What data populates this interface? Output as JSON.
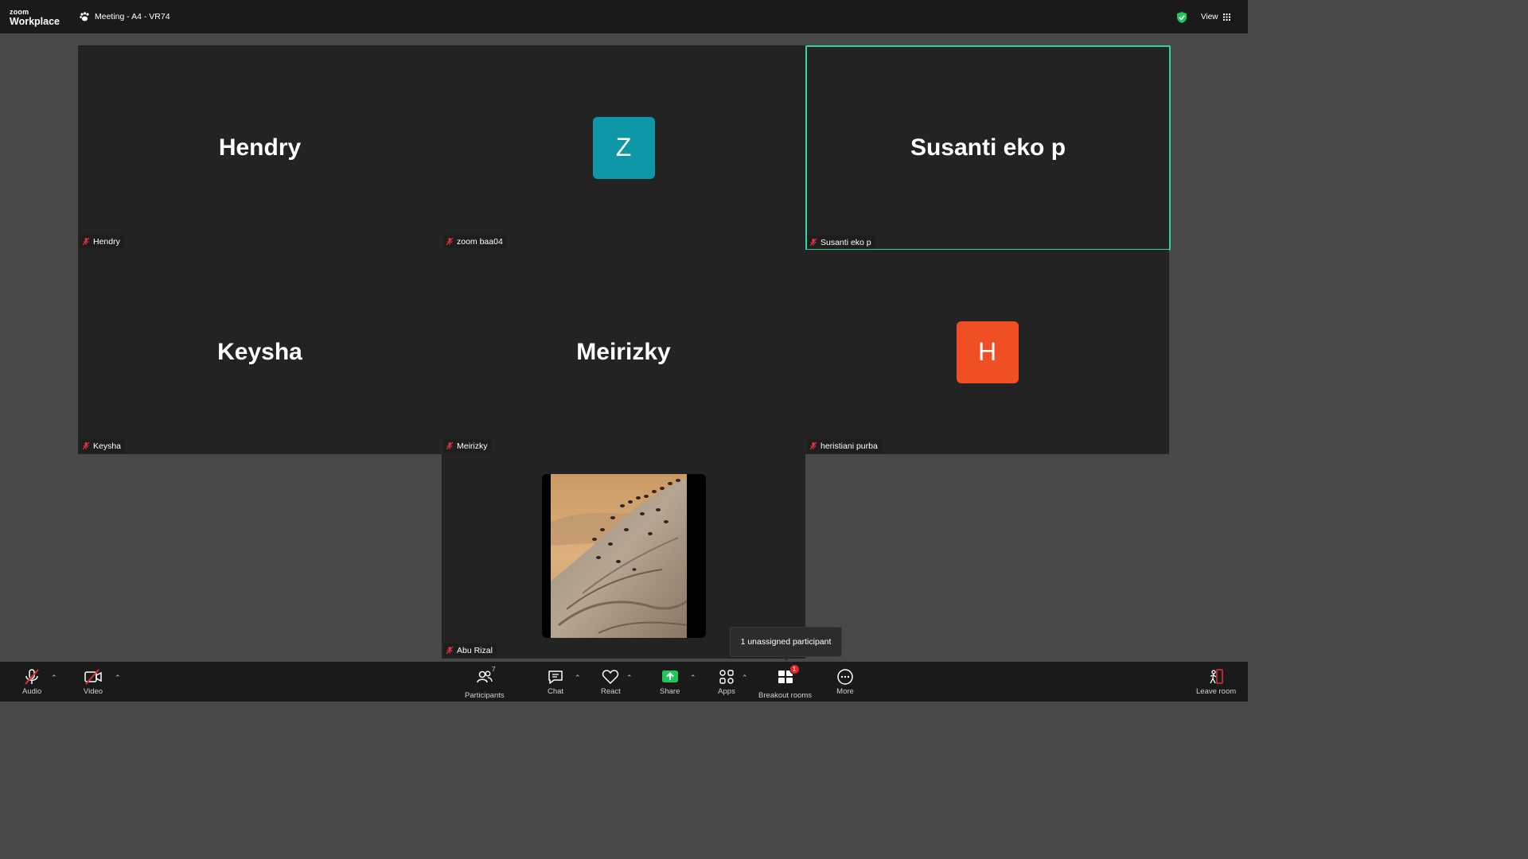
{
  "titlebar": {
    "logo_line1": "zoom",
    "logo_line2": "Workplace",
    "meeting_title": "Meeting - A4 - VR74",
    "view_label": "View"
  },
  "tiles": [
    {
      "display": "Hendry",
      "label": "Hendry",
      "type": "name"
    },
    {
      "display": "Z",
      "label": "zoom baa04",
      "type": "avatar",
      "color": "#0e97a7"
    },
    {
      "display": "Susanti eko p",
      "label": "Susanti eko p",
      "type": "name",
      "active": true
    },
    {
      "display": "Keysha",
      "label": "Keysha",
      "type": "name"
    },
    {
      "display": "Meirizky",
      "label": "Meirizky",
      "type": "name"
    },
    {
      "display": "H",
      "label": "heristiani purba",
      "type": "avatar",
      "color": "#f04e23"
    },
    {
      "label": "Abu Rizal",
      "type": "video"
    }
  ],
  "tooltip": "1 unassigned participant",
  "toolbar": {
    "audio": "Audio",
    "video": "Video",
    "participants": "Participants",
    "participants_count": "7",
    "chat": "Chat",
    "react": "React",
    "share": "Share",
    "apps": "Apps",
    "breakout_rooms": "Breakout rooms",
    "breakout_badge": "1",
    "more": "More",
    "leave": "Leave room"
  },
  "colors": {
    "active_speaker": "#2bd5a5",
    "share_green": "#20c65a",
    "muted_red": "#e0313c"
  }
}
